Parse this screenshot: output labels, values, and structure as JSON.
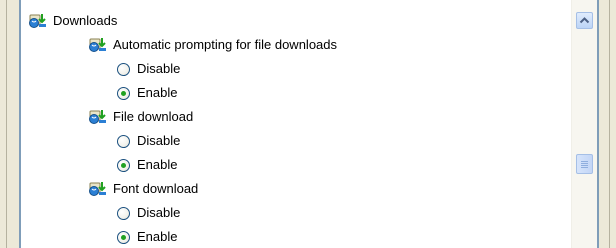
{
  "tree": {
    "root_label": "Downloads",
    "groups": [
      {
        "label": "Automatic prompting for file downloads",
        "options": [
          {
            "label": "Disable",
            "checked": false
          },
          {
            "label": "Enable",
            "checked": true
          }
        ]
      },
      {
        "label": "File download",
        "options": [
          {
            "label": "Disable",
            "checked": false
          },
          {
            "label": "Enable",
            "checked": true
          }
        ]
      },
      {
        "label": "Font download",
        "options": [
          {
            "label": "Disable",
            "checked": false
          },
          {
            "label": "Enable",
            "checked": true
          }
        ]
      }
    ]
  },
  "icons": {
    "folder": "settings-folder-icon",
    "scroll_up": "chevron-up-icon",
    "thumb": "scroll-thumb-grip-icon"
  },
  "colors": {
    "panel_border": "#7f9db9",
    "radio_dot": "#21a121",
    "scroll_button": "#bcd4f6"
  }
}
